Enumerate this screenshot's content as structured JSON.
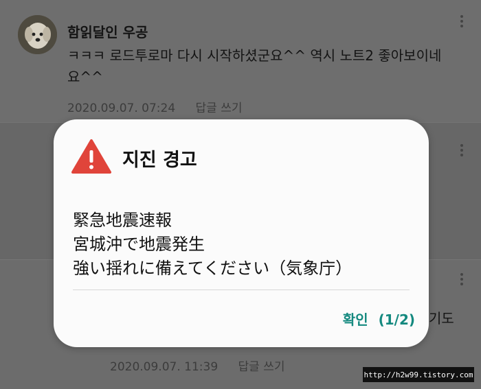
{
  "comments": [
    {
      "author": "함읽달인 우공",
      "text": "ㅋㅋㅋ 로드투로마 다시 시작하셨군요^^ 역시 노트2 좋아보이네요^^",
      "date": "2020.09.07. 07:24",
      "reply_label": "답글 쓰기"
    },
    {
      "trailing_text": "기도",
      "date": "2020.09.07. 11:39",
      "reply_label": "답글 쓰기"
    }
  ],
  "alert": {
    "icon": "warning-triangle-icon",
    "icon_color": "#e0443a",
    "title": "지진 경고",
    "lines": [
      "緊急地震速報",
      "宮城沖で地震発生",
      "強い揺れに備えてください（気象庁）"
    ],
    "confirm_label": "확인",
    "page_indicator": "(1/2)",
    "accent_color": "#14897f"
  },
  "watermark": "http://h2w99.tistory.com"
}
